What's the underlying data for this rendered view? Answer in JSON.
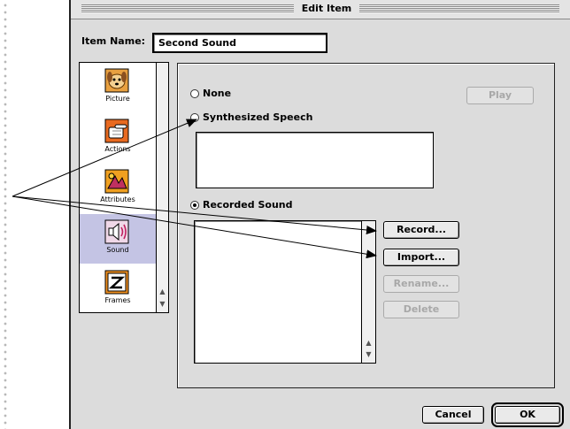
{
  "window": {
    "title": "Edit Item"
  },
  "item_name": {
    "label": "Item Name:",
    "value": "Second Sound"
  },
  "icon_list": [
    {
      "label": "Picture",
      "icon": "dog-picture-icon"
    },
    {
      "label": "Actions",
      "icon": "hand-pointer-icon"
    },
    {
      "label": "Attributes",
      "icon": "attributes-icon"
    },
    {
      "label": "Sound",
      "icon": "speaker-icon",
      "selected": true
    },
    {
      "label": "Frames",
      "icon": "film-frames-icon"
    }
  ],
  "sound_options": {
    "none": "None",
    "synthesized_speech": "Synthesized Speech",
    "recorded_sound": "Recorded Sound",
    "selected": "recorded_sound"
  },
  "buttons": {
    "play": "Play",
    "record": "Record...",
    "import": "Import...",
    "rename": "Rename...",
    "delete": "Delete",
    "cancel": "Cancel",
    "ok": "OK"
  },
  "colors": {
    "selection": "#c4c4e4",
    "window_bg": "#dcdcdc"
  }
}
